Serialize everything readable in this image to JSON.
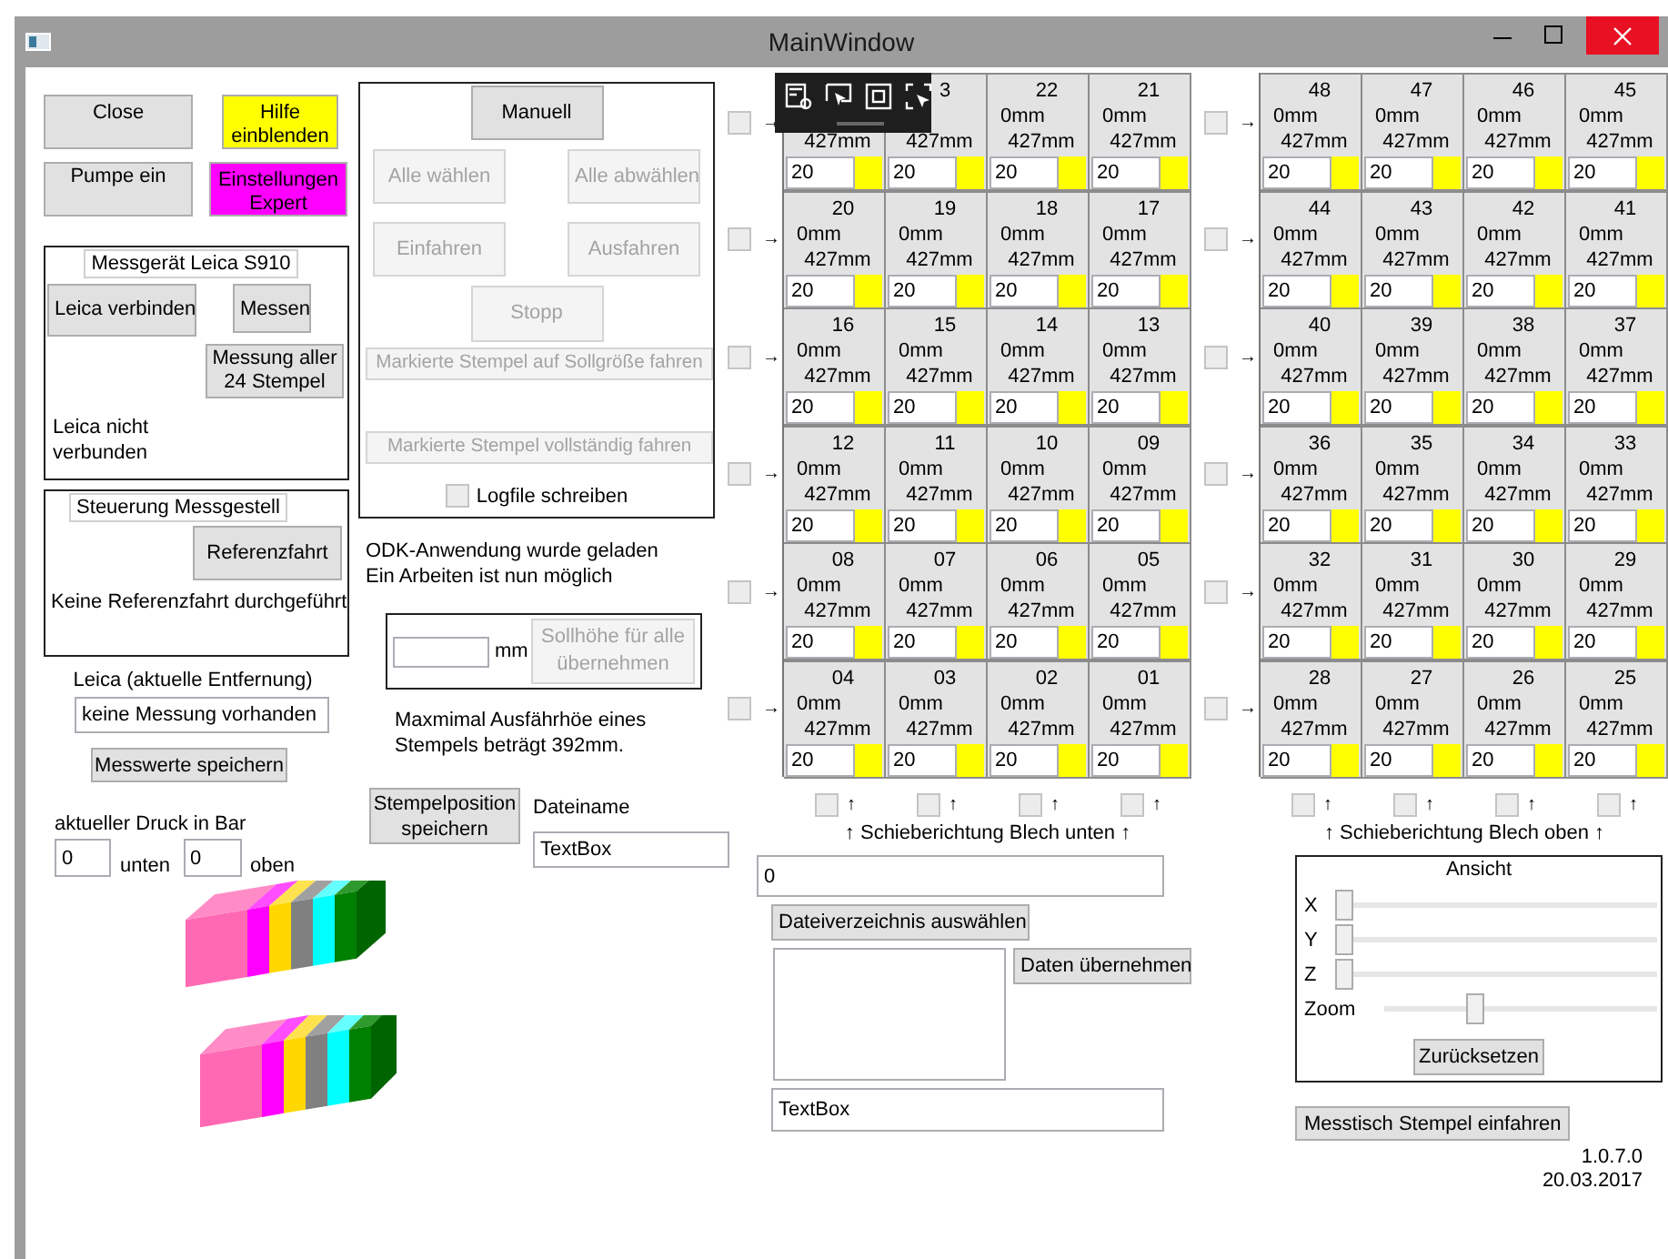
{
  "window": {
    "title": "MainWindow"
  },
  "quick_buttons": [
    {
      "label": "Close",
      "color": "#e1e1e1"
    },
    {
      "label": "Hilfe einblenden",
      "color": "#ffff00"
    },
    {
      "label": "Pumpe ein",
      "color": "#e1e1e1"
    },
    {
      "label": "Einstellungen Expert",
      "color": "#ff00ff"
    }
  ],
  "leica_group": {
    "title": "Messgerät Leica S910",
    "buttons": [
      "Leica verbinden",
      "Messen",
      "Messung aller 24 Stempel"
    ],
    "status": "Leica nicht verbunden"
  },
  "rig_group": {
    "title": "Steuerung Messgestell",
    "button": "Referenzfahrt",
    "status": "Keine Referenzfahrt durchgeführt"
  },
  "distance": {
    "label": "Leica (aktuelle Entfernung)",
    "value": "keine Messung vorhanden",
    "button": "Messwerte speichern"
  },
  "pressure": {
    "label": "aktueller Druck in Bar",
    "fields": [
      {
        "value": "0",
        "suffix": "unten"
      },
      {
        "value": "0",
        "suffix": "oben"
      }
    ]
  },
  "manual_group": {
    "mode_button": "Manuell",
    "buttons": [
      {
        "label": "Alle wählen",
        "disabled": true
      },
      {
        "label": "Alle abwählen",
        "disabled": true
      },
      {
        "label": "Einfahren",
        "disabled": true
      },
      {
        "label": "Ausfahren",
        "disabled": true
      },
      {
        "label": "Stopp",
        "disabled": true
      },
      {
        "label": "Markierte Stempel auf Sollgröße fahren",
        "disabled": true
      },
      {
        "label": "Markierte Stempel vollständig fahren",
        "disabled": true
      }
    ],
    "logfile": {
      "label": "Logfile schreiben",
      "checked": false
    }
  },
  "status_message": "ODK-Anwendung wurde geladen Ein Arbeiten ist nun möglich",
  "setpoint": {
    "unit": "mm",
    "button": {
      "label": "Sollhöhe für alle übernehmen",
      "disabled": true
    }
  },
  "max_note": "Maxmimal Ausfährhöe eines Stempels beträgt 392mm.",
  "save_position_button": "Stempelposition speichern",
  "filename": {
    "label": "Dateiname",
    "value": "TextBox"
  },
  "blocks": [
    {
      "rows": [
        {
          "checked": false,
          "arrow": "→",
          "cells": [
            {
              "height": "427mm",
              "value": "20",
              "color": "#ffff00"
            },
            {
              "number": "3",
              "height": "427mm",
              "value": "20",
              "color": "#ffff00"
            },
            {
              "number": "22",
              "position": "0mm",
              "height": "427mm",
              "value": "20",
              "color": "#ffff00"
            },
            {
              "number": "21",
              "position": "0mm",
              "height": "427mm",
              "value": "20",
              "color": "#ffff00"
            }
          ]
        },
        {
          "checked": false,
          "arrow": "→",
          "cells": [
            {
              "number": "20",
              "position": "0mm",
              "height": "427mm",
              "value": "20",
              "color": "#ffff00"
            },
            {
              "number": "19",
              "position": "0mm",
              "height": "427mm",
              "value": "20",
              "color": "#ffff00"
            },
            {
              "number": "18",
              "position": "0mm",
              "height": "427mm",
              "value": "20",
              "color": "#ffff00"
            },
            {
              "number": "17",
              "position": "0mm",
              "height": "427mm",
              "value": "20",
              "color": "#ffff00"
            }
          ]
        },
        {
          "checked": false,
          "arrow": "→",
          "cells": [
            {
              "number": "16",
              "position": "0mm",
              "height": "427mm",
              "value": "20",
              "color": "#ffff00"
            },
            {
              "number": "15",
              "position": "0mm",
              "height": "427mm",
              "value": "20",
              "color": "#ffff00"
            },
            {
              "number": "14",
              "position": "0mm",
              "height": "427mm",
              "value": "20",
              "color": "#ffff00"
            },
            {
              "number": "13",
              "position": "0mm",
              "height": "427mm",
              "value": "20",
              "color": "#ffff00"
            }
          ]
        },
        {
          "checked": false,
          "arrow": "→",
          "cells": [
            {
              "number": "12",
              "position": "0mm",
              "height": "427mm",
              "value": "20",
              "color": "#ffff00"
            },
            {
              "number": "11",
              "position": "0mm",
              "height": "427mm",
              "value": "20",
              "color": "#ffff00"
            },
            {
              "number": "10",
              "position": "0mm",
              "height": "427mm",
              "value": "20",
              "color": "#ffff00"
            },
            {
              "number": "09",
              "position": "0mm",
              "height": "427mm",
              "value": "20",
              "color": "#ffff00"
            }
          ]
        },
        {
          "checked": false,
          "arrow": "→",
          "cells": [
            {
              "number": "08",
              "position": "0mm",
              "height": "427mm",
              "value": "20",
              "color": "#ffff00"
            },
            {
              "number": "07",
              "position": "0mm",
              "height": "427mm",
              "value": "20",
              "color": "#ffff00"
            },
            {
              "number": "06",
              "position": "0mm",
              "height": "427mm",
              "value": "20",
              "color": "#ffff00"
            },
            {
              "number": "05",
              "position": "0mm",
              "height": "427mm",
              "value": "20",
              "color": "#ffff00"
            }
          ]
        },
        {
          "checked": false,
          "arrow": "→",
          "cells": [
            {
              "number": "04",
              "position": "0mm",
              "height": "427mm",
              "value": "20",
              "color": "#ffff00"
            },
            {
              "number": "03",
              "position": "0mm",
              "height": "427mm",
              "value": "20",
              "color": "#ffff00"
            },
            {
              "number": "02",
              "position": "0mm",
              "height": "427mm",
              "value": "20",
              "color": "#ffff00"
            },
            {
              "number": "01",
              "position": "0mm",
              "height": "427mm",
              "value": "20",
              "color": "#ffff00"
            }
          ]
        }
      ],
      "column_checks": [
        {
          "checked": false,
          "arrow": "↑"
        },
        {
          "checked": false,
          "arrow": "↑"
        },
        {
          "checked": false,
          "arrow": "↑"
        },
        {
          "checked": false,
          "arrow": "↑"
        }
      ],
      "caption": "↑ Schieberichtung Blech unten ↑"
    },
    {
      "rows": [
        {
          "checked": false,
          "arrow": "→",
          "cells": [
            {
              "number": "48",
              "position": "0mm",
              "height": "427mm",
              "value": "20",
              "color": "#ffff00"
            },
            {
              "number": "47",
              "position": "0mm",
              "height": "427mm",
              "value": "20",
              "color": "#ffff00"
            },
            {
              "number": "46",
              "position": "0mm",
              "height": "427mm",
              "value": "20",
              "color": "#ffff00"
            },
            {
              "number": "45",
              "position": "0mm",
              "height": "427mm",
              "value": "20",
              "color": "#ffff00"
            }
          ]
        },
        {
          "checked": false,
          "arrow": "→",
          "cells": [
            {
              "number": "44",
              "position": "0mm",
              "height": "427mm",
              "value": "20",
              "color": "#ffff00"
            },
            {
              "number": "43",
              "position": "0mm",
              "height": "427mm",
              "value": "20",
              "color": "#ffff00"
            },
            {
              "number": "42",
              "position": "0mm",
              "height": "427mm",
              "value": "20",
              "color": "#ffff00"
            },
            {
              "number": "41",
              "position": "0mm",
              "height": "427mm",
              "value": "20",
              "color": "#ffff00"
            }
          ]
        },
        {
          "checked": false,
          "arrow": "→",
          "cells": [
            {
              "number": "40",
              "position": "0mm",
              "height": "427mm",
              "value": "20",
              "color": "#ffff00"
            },
            {
              "number": "39",
              "position": "0mm",
              "height": "427mm",
              "value": "20",
              "color": "#ffff00"
            },
            {
              "number": "38",
              "position": "0mm",
              "height": "427mm",
              "value": "20",
              "color": "#ffff00"
            },
            {
              "number": "37",
              "position": "0mm",
              "height": "427mm",
              "value": "20",
              "color": "#ffff00"
            }
          ]
        },
        {
          "checked": false,
          "arrow": "→",
          "cells": [
            {
              "number": "36",
              "position": "0mm",
              "height": "427mm",
              "value": "20",
              "color": "#ffff00"
            },
            {
              "number": "35",
              "position": "0mm",
              "height": "427mm",
              "value": "20",
              "color": "#ffff00"
            },
            {
              "number": "34",
              "position": "0mm",
              "height": "427mm",
              "value": "20",
              "color": "#ffff00"
            },
            {
              "number": "33",
              "position": "0mm",
              "height": "427mm",
              "value": "20",
              "color": "#ffff00"
            }
          ]
        },
        {
          "checked": false,
          "arrow": "→",
          "cells": [
            {
              "number": "32",
              "position": "0mm",
              "height": "427mm",
              "value": "20",
              "color": "#ffff00"
            },
            {
              "number": "31",
              "position": "0mm",
              "height": "427mm",
              "value": "20",
              "color": "#ffff00"
            },
            {
              "number": "30",
              "position": "0mm",
              "height": "427mm",
              "value": "20",
              "color": "#ffff00"
            },
            {
              "number": "29",
              "position": "0mm",
              "height": "427mm",
              "value": "20",
              "color": "#ffff00"
            }
          ]
        },
        {
          "checked": false,
          "arrow": "→",
          "cells": [
            {
              "number": "28",
              "position": "0mm",
              "height": "427mm",
              "value": "20",
              "color": "#ffff00"
            },
            {
              "number": "27",
              "position": "0mm",
              "height": "427mm",
              "value": "20",
              "color": "#ffff00"
            },
            {
              "number": "26",
              "position": "0mm",
              "height": "427mm",
              "value": "20",
              "color": "#ffff00"
            },
            {
              "number": "25",
              "position": "0mm",
              "height": "427mm",
              "value": "20",
              "color": "#ffff00"
            }
          ]
        }
      ],
      "column_checks": [
        {
          "checked": false,
          "arrow": "↑"
        },
        {
          "checked": false,
          "arrow": "↑"
        },
        {
          "checked": false,
          "arrow": "↑"
        },
        {
          "checked": false,
          "arrow": "↑"
        }
      ],
      "caption": "↑ Schieberichtung Blech oben ↑"
    }
  ],
  "file_panel": {
    "path": "0",
    "choose_button": "Dateiverzeichnis auswählen",
    "apply_button": "Daten übernehmen",
    "text": "TextBox"
  },
  "view_panel": {
    "title": "Ansicht",
    "sliders": [
      {
        "label": "X",
        "level": 0
      },
      {
        "label": "Y",
        "level": 0
      },
      {
        "label": "Z",
        "level": 0
      },
      {
        "label": "Zoom",
        "level": 0.32
      }
    ],
    "reset_button": "Zurücksetzen"
  },
  "retract_button": "Messtisch Stempel einfahren",
  "version": "1.0.7.0",
  "date": "20.03.2017"
}
